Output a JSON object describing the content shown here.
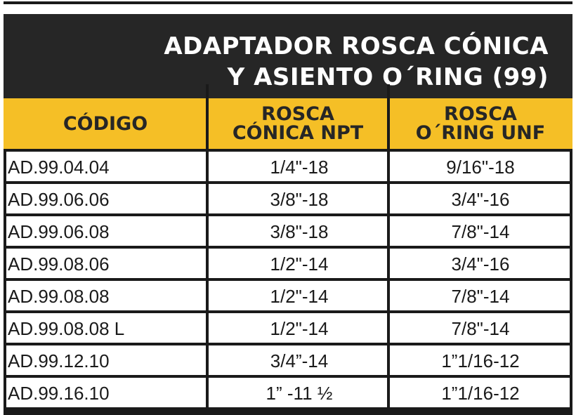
{
  "title_lines": [
    "ADAPTADOR ROSCA CÓNICA",
    "Y ASIENTO O´RING (99)"
  ],
  "columns": [
    {
      "lines": [
        "CÓDIGO"
      ]
    },
    {
      "lines": [
        "ROSCA",
        "CÓNICA NPT"
      ]
    },
    {
      "lines": [
        "ROSCA",
        "O´RING UNF"
      ]
    }
  ],
  "rows": [
    {
      "codigo": "AD.99.04.04",
      "npt": "1/4\"-18",
      "unf": "9/16\"-18"
    },
    {
      "codigo": "AD.99.06.06",
      "npt": "3/8\"-18",
      "unf": "3/4\"-16"
    },
    {
      "codigo": "AD.99.06.08",
      "npt": "3/8\"-18",
      "unf": "7/8\"-14"
    },
    {
      "codigo": "AD.99.08.06",
      "npt": "1/2\"-14",
      "unf": "3/4\"-16"
    },
    {
      "codigo": "AD.99.08.08",
      "npt": "1/2\"-14",
      "unf": "7/8\"-14"
    },
    {
      "codigo": "AD.99.08.08 L",
      "npt": "1/2\"-14",
      "unf": "7/8\"-14"
    },
    {
      "codigo": "AD.99.12.10",
      "npt": "3/4”-14",
      "unf": "1”1/16-12"
    },
    {
      "codigo": "AD.99.16.10",
      "npt": "1” -11 ½",
      "unf": "1”1/16-12"
    }
  ],
  "colors": {
    "banner": "#262626",
    "header": "#f5bf26",
    "border": "#1a1a1a",
    "text": "#1a1a1a"
  }
}
